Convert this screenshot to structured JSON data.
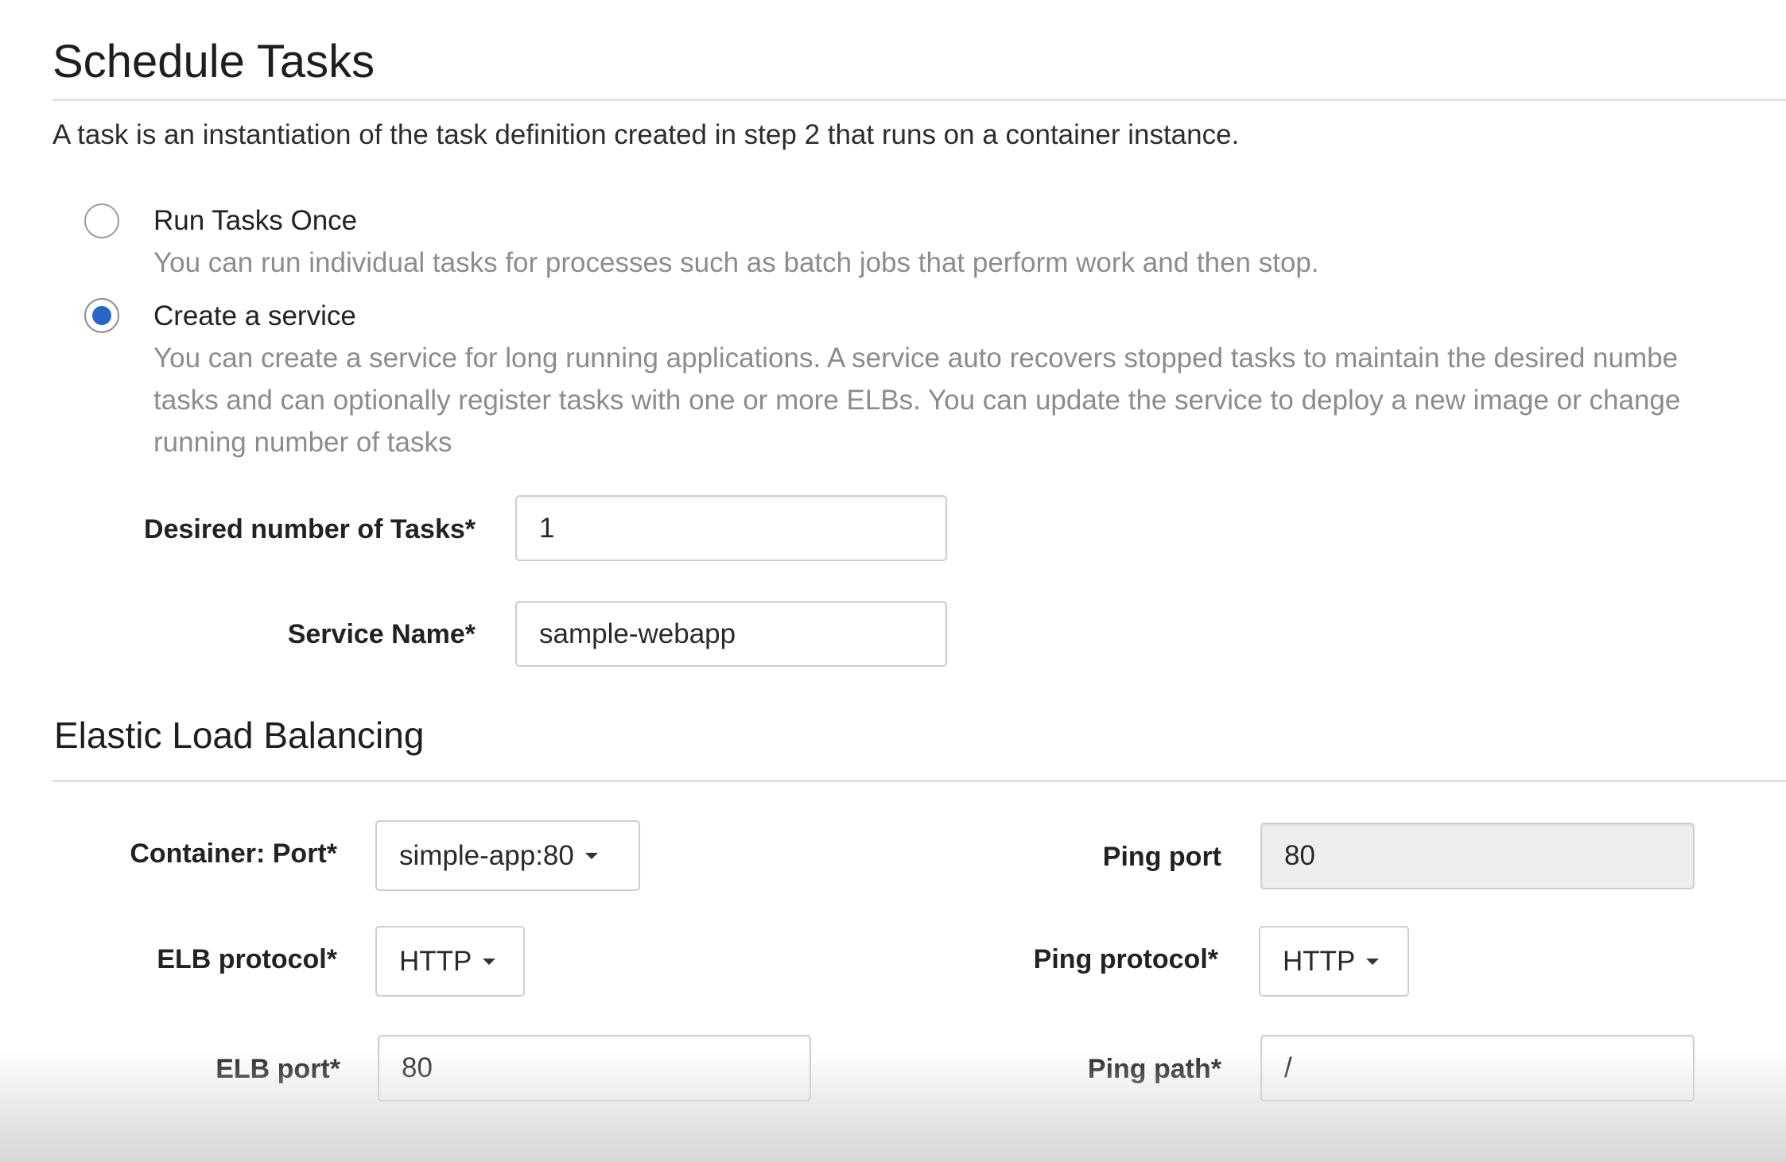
{
  "section": {
    "title": "Schedule Tasks",
    "description": "A task is an instantiation of the task definition created in step 2 that runs on a container instance."
  },
  "options": {
    "run_once": {
      "title": "Run Tasks Once",
      "description": "You can run individual tasks for processes such as batch jobs that perform work and then stop.",
      "selected": false
    },
    "create_service": {
      "title": "Create a service",
      "description_lines": [
        "You can create a service for long running applications. A service auto recovers stopped tasks to maintain the desired numbe",
        "tasks and can optionally register tasks with one or more ELBs. You can update the service to deploy a new image or change",
        "running number of tasks"
      ],
      "selected": true
    }
  },
  "service_form": {
    "desired_tasks_label": "Desired number of Tasks*",
    "desired_tasks_value": "1",
    "service_name_label": "Service Name*",
    "service_name_value": "sample-webapp"
  },
  "elb": {
    "title": "Elastic Load Balancing",
    "container_port_label": "Container: Port*",
    "container_port_value": "simple-app:80",
    "elb_protocol_label": "ELB protocol*",
    "elb_protocol_value": "HTTP",
    "elb_port_label": "ELB port*",
    "elb_port_value": "80",
    "ping_port_label": "Ping port",
    "ping_port_value": "80",
    "ping_protocol_label": "Ping protocol*",
    "ping_protocol_value": "HTTP",
    "ping_path_label": "Ping path*",
    "ping_path_value": "/"
  },
  "colors": {
    "accent": "#2566c7",
    "muted_text": "#8c8c8c",
    "divider": "#e3e3e3",
    "readonly_bg": "#eeeeee"
  }
}
